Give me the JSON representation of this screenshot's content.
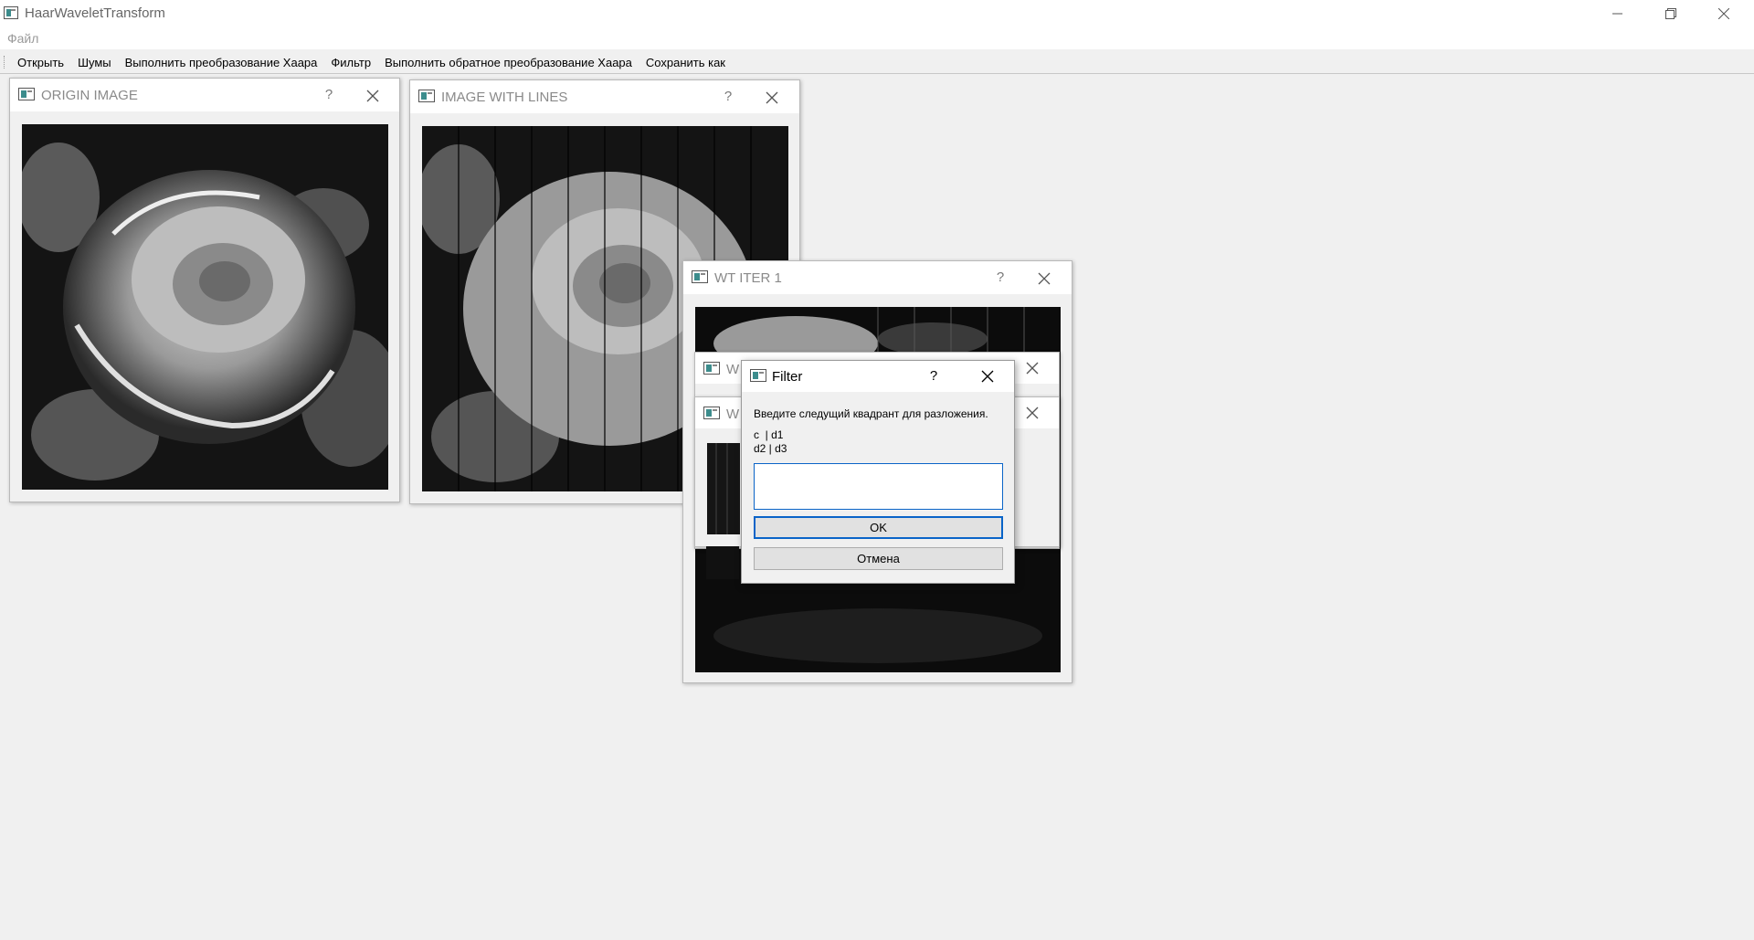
{
  "app": {
    "title": "HaarWaveletTransform",
    "menu_file": "Файл"
  },
  "toolbar": {
    "actions": [
      "Открыть",
      "Шумы",
      "Выполнить преобразование Хаара",
      "Фильтр",
      "Выполнить обратное преобразование Хаара",
      "Сохранить как"
    ]
  },
  "windows": {
    "origin": {
      "title": "ORIGIN IMAGE",
      "help": "?"
    },
    "lines": {
      "title": "IMAGE WITH LINES",
      "help": "?"
    },
    "wt1": {
      "title": "WT ITER 1",
      "help": "?"
    },
    "wt2": {
      "title": "W"
    },
    "wt3": {
      "title": "W"
    }
  },
  "dialog": {
    "title": "Filter",
    "help": "?",
    "prompt": "Введите следущий квадрант для разложения.",
    "layout_line1": "c  | d1",
    "layout_line2": "d2 | d3",
    "input_value": "",
    "ok_label": "OK",
    "cancel_label": "Отмена"
  },
  "icons": {
    "minimize": "minimize-icon",
    "maximize": "restore-icon",
    "close": "close-icon",
    "app": "app-window-icon"
  }
}
